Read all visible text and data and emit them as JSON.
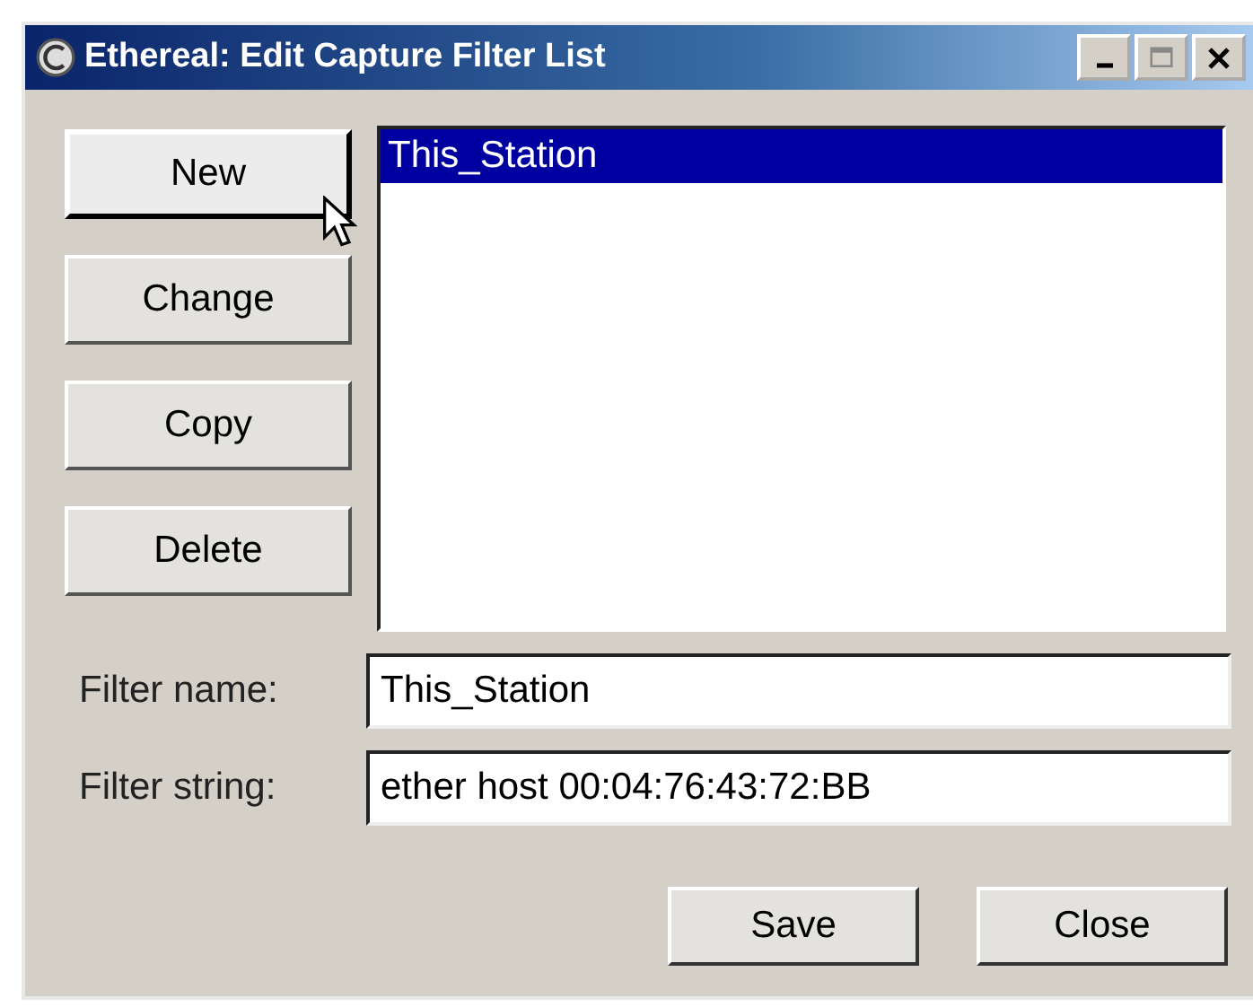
{
  "window": {
    "title": "Ethereal: Edit Capture Filter List"
  },
  "side_buttons": [
    {
      "label": "New",
      "default": true
    },
    {
      "label": "Change",
      "default": false
    },
    {
      "label": "Copy",
      "default": false
    },
    {
      "label": "Delete",
      "default": false
    }
  ],
  "filter_list": [
    {
      "label": "This_Station",
      "selected": true
    }
  ],
  "fields": [
    {
      "label": "Filter name:",
      "value": "This_Station"
    },
    {
      "label": "Filter string:",
      "value": "ether host 00:04:76:43:72:BB"
    }
  ],
  "buttons": [
    "Save",
    "Close"
  ]
}
